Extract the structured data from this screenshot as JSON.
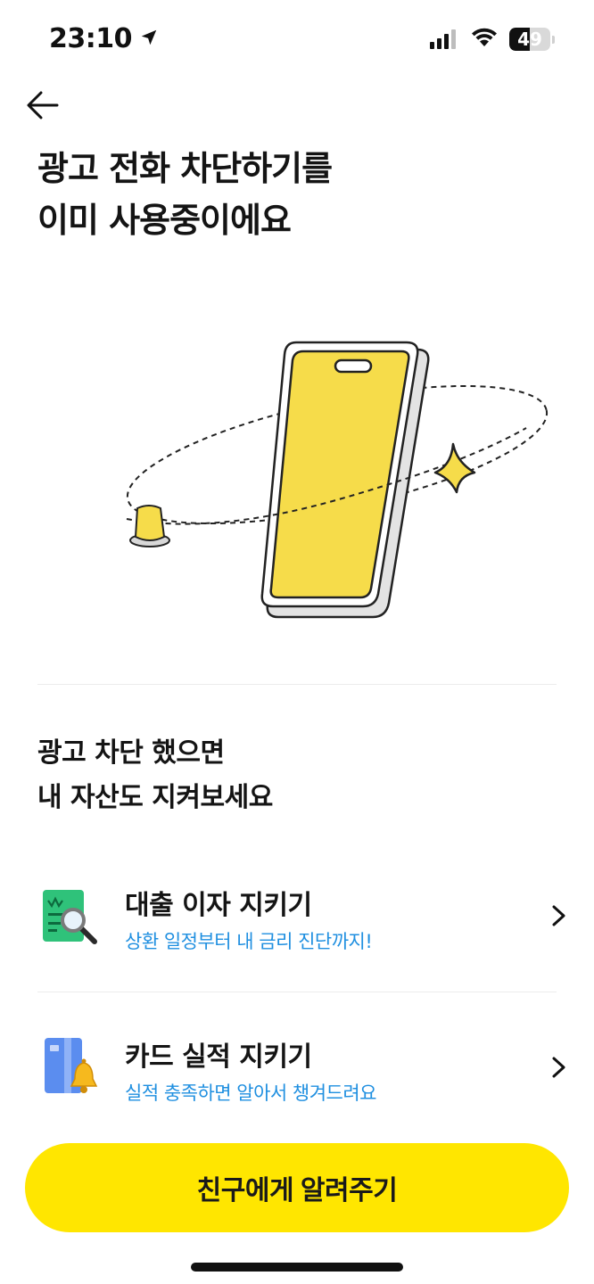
{
  "status_bar": {
    "time": "23:10",
    "battery_percent": "49",
    "battery_level": 0.49
  },
  "header": {
    "back_icon": "arrow-left-icon"
  },
  "headline": {
    "line1": "광고 전화 차단하기를",
    "line2": "이미 사용중이에요"
  },
  "section": {
    "line1": "광고 차단 했으면",
    "line2": "내 자산도 지켜보세요"
  },
  "items": [
    {
      "title": "대출 이자 지키기",
      "description": "상환 일정부터 내 금리 진단까지!",
      "icon": "loan-document-magnifier-icon"
    },
    {
      "title": "카드 실적 지키기",
      "description": "실적 충족하면 알아서 챙겨드려요",
      "icon": "card-bell-icon"
    }
  ],
  "cta": {
    "label": "친구에게 알려주기"
  },
  "colors": {
    "accent_yellow": "#ffe600",
    "link_blue": "#1f8fe0",
    "phone_yellow": "#f6dc4a"
  }
}
